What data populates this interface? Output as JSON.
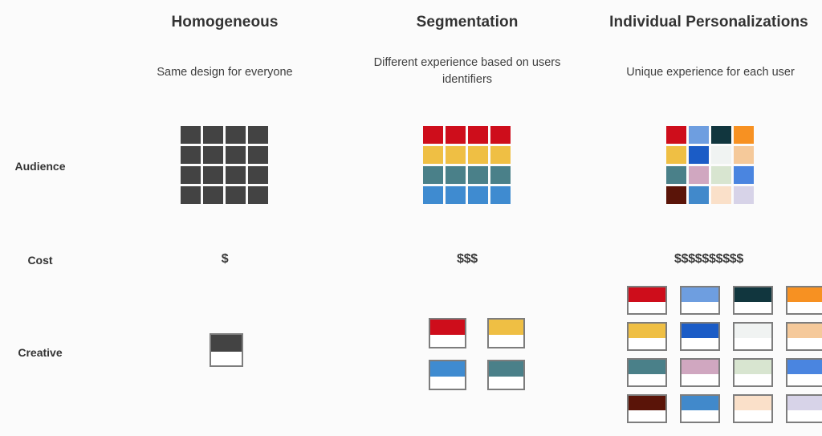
{
  "diagram": {
    "title_row": {
      "columns": [
        {
          "id": "homogeneous",
          "title": "Homogeneous",
          "subtitle": "Same design for everyone"
        },
        {
          "id": "segmentation",
          "title": "Segmentation",
          "subtitle": "Different experience based on users identifiers"
        },
        {
          "id": "individual-personalizations",
          "title": "Individual Personalizations",
          "subtitle": "Unique experience for each user"
        }
      ]
    },
    "rows": [
      {
        "id": "audience",
        "label": "Audience"
      },
      {
        "id": "cost",
        "label": "Cost"
      },
      {
        "id": "creative",
        "label": "Creative"
      }
    ],
    "cost": {
      "homogeneous": "$",
      "segmentation": "$$$",
      "individual": "$$$$$$$$$$"
    },
    "audience": {
      "homogeneous": [
        [
          "#434343",
          "#434343",
          "#434343",
          "#434343"
        ],
        [
          "#434343",
          "#434343",
          "#434343",
          "#434343"
        ],
        [
          "#434343",
          "#434343",
          "#434343",
          "#434343"
        ],
        [
          "#434343",
          "#434343",
          "#434343",
          "#434343"
        ]
      ],
      "segmentation": [
        [
          "#ce0d1b",
          "#ce0d1b",
          "#ce0d1b",
          "#ce0d1b"
        ],
        [
          "#efbf44",
          "#efbf44",
          "#efbf44",
          "#efbf44"
        ],
        [
          "#4a8089",
          "#4a8089",
          "#4a8089",
          "#4a8089"
        ],
        [
          "#3f8bd0",
          "#3f8bd0",
          "#3f8bd0",
          "#3f8bd0"
        ]
      ],
      "individual": [
        [
          "#ce0d1b",
          "#6e9ee0",
          "#11363e",
          "#f79122"
        ],
        [
          "#efbf44",
          "#1b5cc6",
          "#f0f3f2",
          "#f5c99a"
        ],
        [
          "#4a8089",
          "#d0a7c0",
          "#d8e5d0",
          "#4a85e0"
        ],
        [
          "#5a1408",
          "#4189cb",
          "#fae0c9",
          "#d7d3e8"
        ]
      ]
    },
    "creative": {
      "homogeneous": [
        [
          "#434343"
        ]
      ],
      "segmentation": [
        [
          "#ce0d1b",
          "#efbf44"
        ],
        [
          "#3f8bd0",
          "#4a8089"
        ]
      ],
      "individual": [
        [
          "#ce0d1b",
          "#6e9ee0",
          "#11363e",
          "#f79122"
        ],
        [
          "#efbf44",
          "#1b5cc6",
          "#f0f3f2",
          "#f5c99a"
        ],
        [
          "#4a8089",
          "#d0a7c0",
          "#d8e5d0",
          "#4a85e0"
        ],
        [
          "#5a1408",
          "#4189cb",
          "#fae0c9",
          "#d7d3e8"
        ]
      ]
    },
    "palette": {
      "background": "#fbfbfb",
      "text": "#333333",
      "card_border": "#7d7d7d",
      "card_body": "#ffffff"
    }
  }
}
